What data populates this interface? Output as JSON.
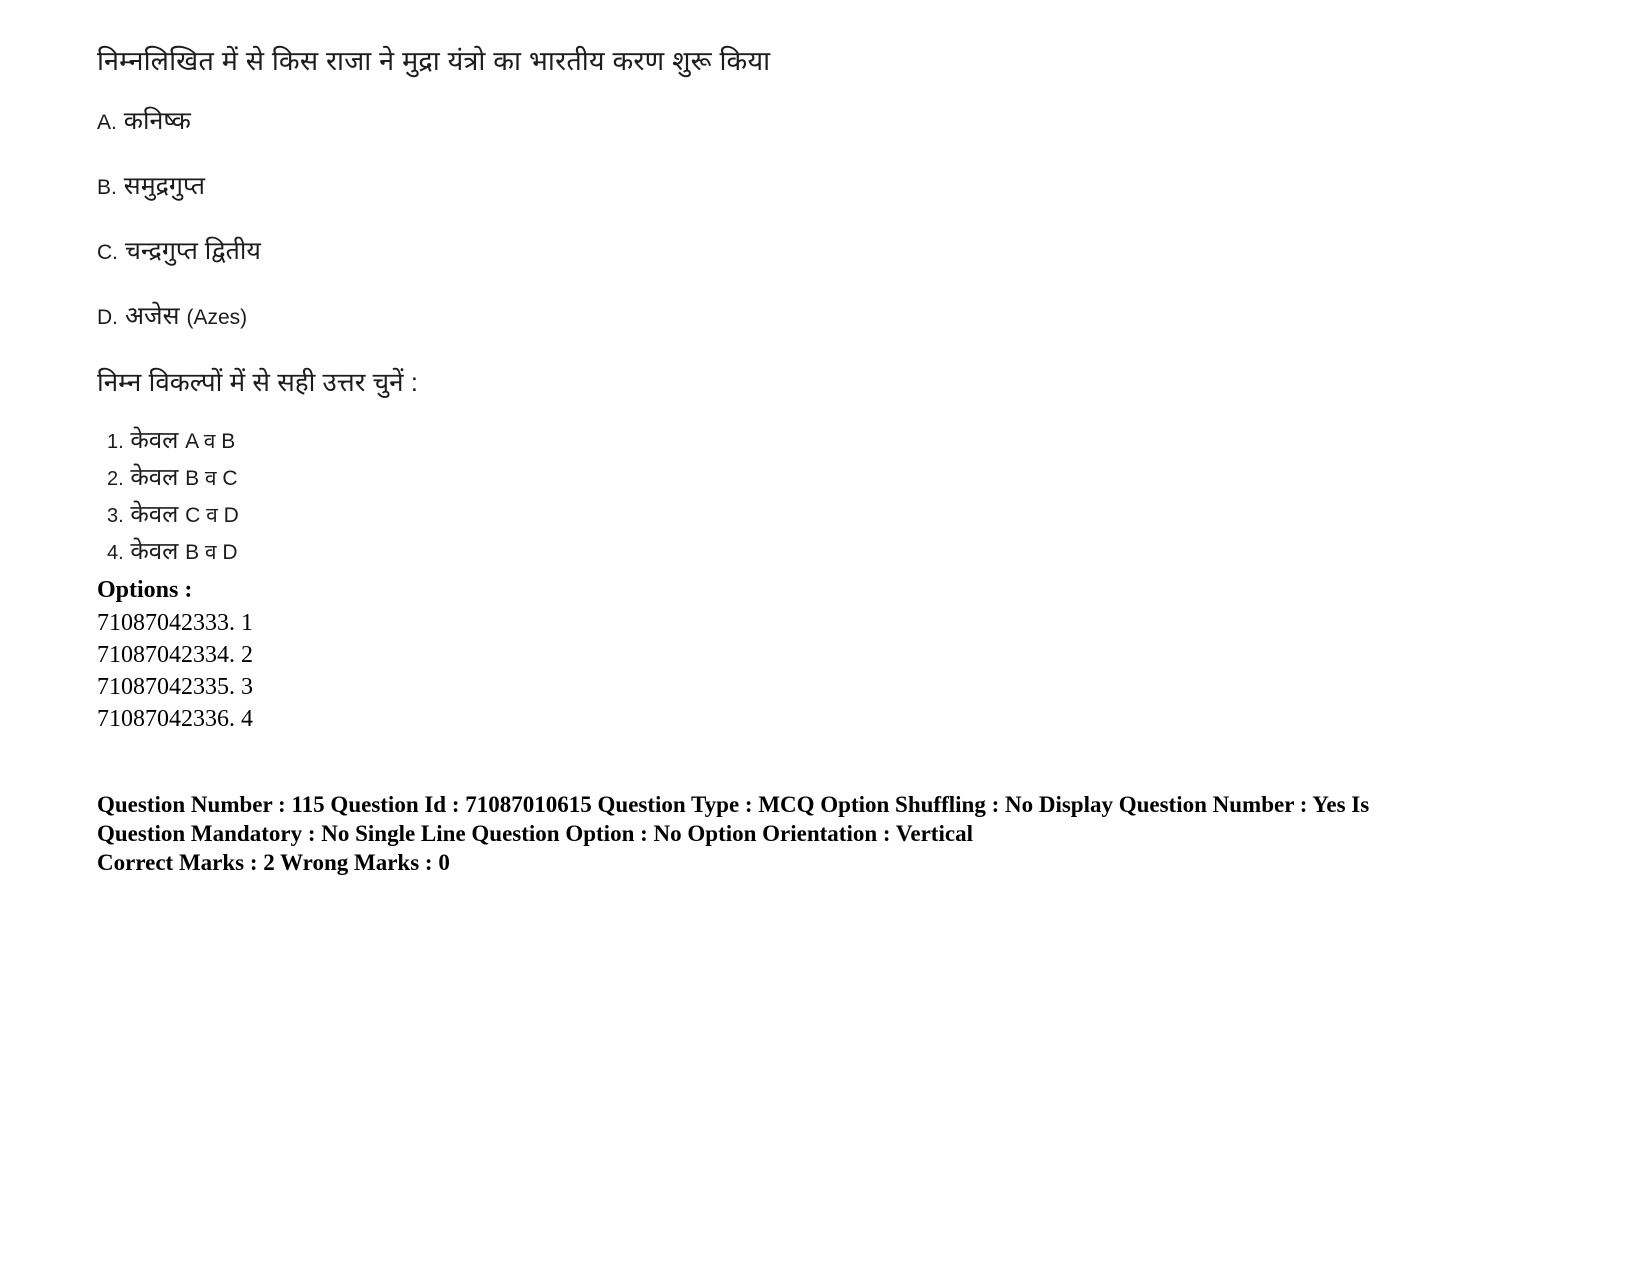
{
  "question": {
    "stem": "निम्नलिखित में से किस राजा ने मुद्रा यंत्रो का भारतीय करण शुरू किया",
    "choices": [
      {
        "label": "A.",
        "text": "कनिष्क",
        "latin": ""
      },
      {
        "label": "B.",
        "text": "समुद्रगुप्त",
        "latin": ""
      },
      {
        "label": "C.",
        "text": "चन्द्रगुप्त द्वितीय",
        "latin": ""
      },
      {
        "label": "D.",
        "text": "अजेस ",
        "latin": "(Azes)"
      }
    ],
    "prompt": "निम्न विकल्पों में से सही उत्तर चुनें :",
    "answer_choices": [
      {
        "num": "1.",
        "text": "केवल ",
        "letters": "A व B"
      },
      {
        "num": "2.",
        "text": "केवल ",
        "letters": "B व C"
      },
      {
        "num": "3.",
        "text": "केवल ",
        "letters": "C व D"
      },
      {
        "num": "4.",
        "text": "केवल ",
        "letters": "B व D"
      }
    ]
  },
  "options": {
    "heading": "Options :",
    "items": [
      "71087042333. 1",
      "71087042334. 2",
      "71087042335. 3",
      "71087042336. 4"
    ]
  },
  "metadata": {
    "line1": "Question Number : 115 Question Id : 71087010615 Question Type : MCQ Option Shuffling : No Display Question Number : Yes Is",
    "line2": "Question Mandatory : No Single Line Question Option : No Option Orientation : Vertical",
    "line3": "Correct Marks : 2 Wrong Marks : 0"
  }
}
